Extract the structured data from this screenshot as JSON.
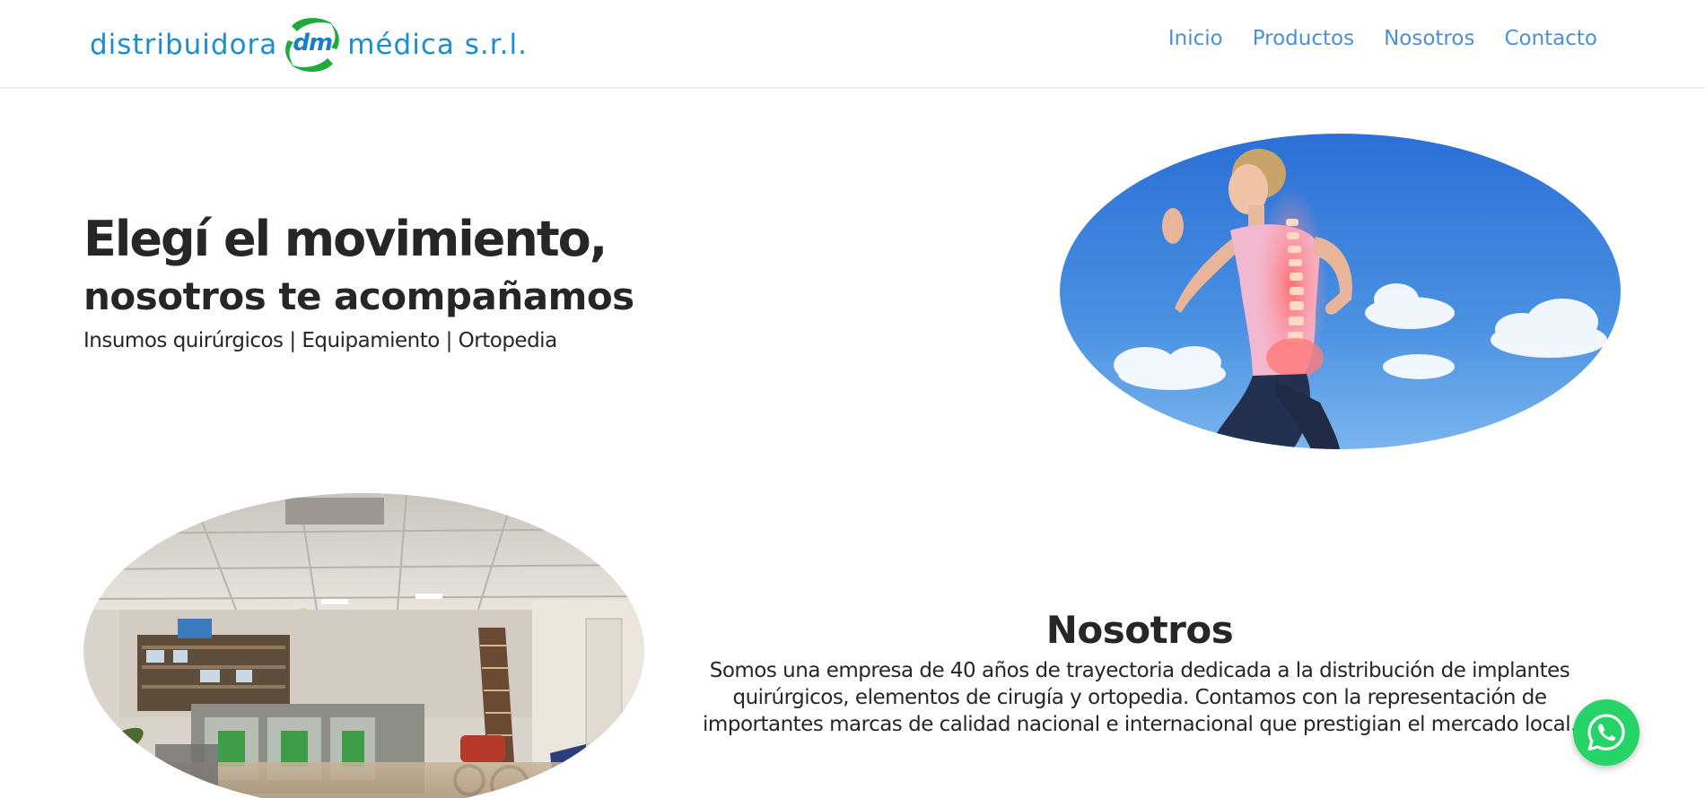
{
  "brand": {
    "name_left": "distribuidora",
    "name_mark": "dm",
    "name_right": "médica s.r.l.",
    "color": "#1b8ed1",
    "accent": "#1faa3b"
  },
  "nav": {
    "items": [
      {
        "label": "Inicio"
      },
      {
        "label": "Productos"
      },
      {
        "label": "Nosotros"
      },
      {
        "label": "Contacto"
      }
    ],
    "color": "#4d8fd4"
  },
  "hero": {
    "title": "Elegí el movimiento,",
    "subtitle": "nosotros te acompañamos",
    "tagline": "Insumos quirúrgicos | Equipamiento | Ortopedia",
    "image_icon": "runner-spine-photo"
  },
  "about": {
    "title": "Nosotros",
    "text": "Somos una empresa de 40 años de trayectoria dedicada a la distribución de implantes quirúrgicos, elementos de cirugía y ortopedia. Contamos con la representación de importantes marcas de calidad nacional e internacional que prestigian el mercado local.",
    "image_icon": "store-interior-photo"
  },
  "whatsapp": {
    "icon": "whatsapp-icon",
    "color": "#25d366"
  }
}
